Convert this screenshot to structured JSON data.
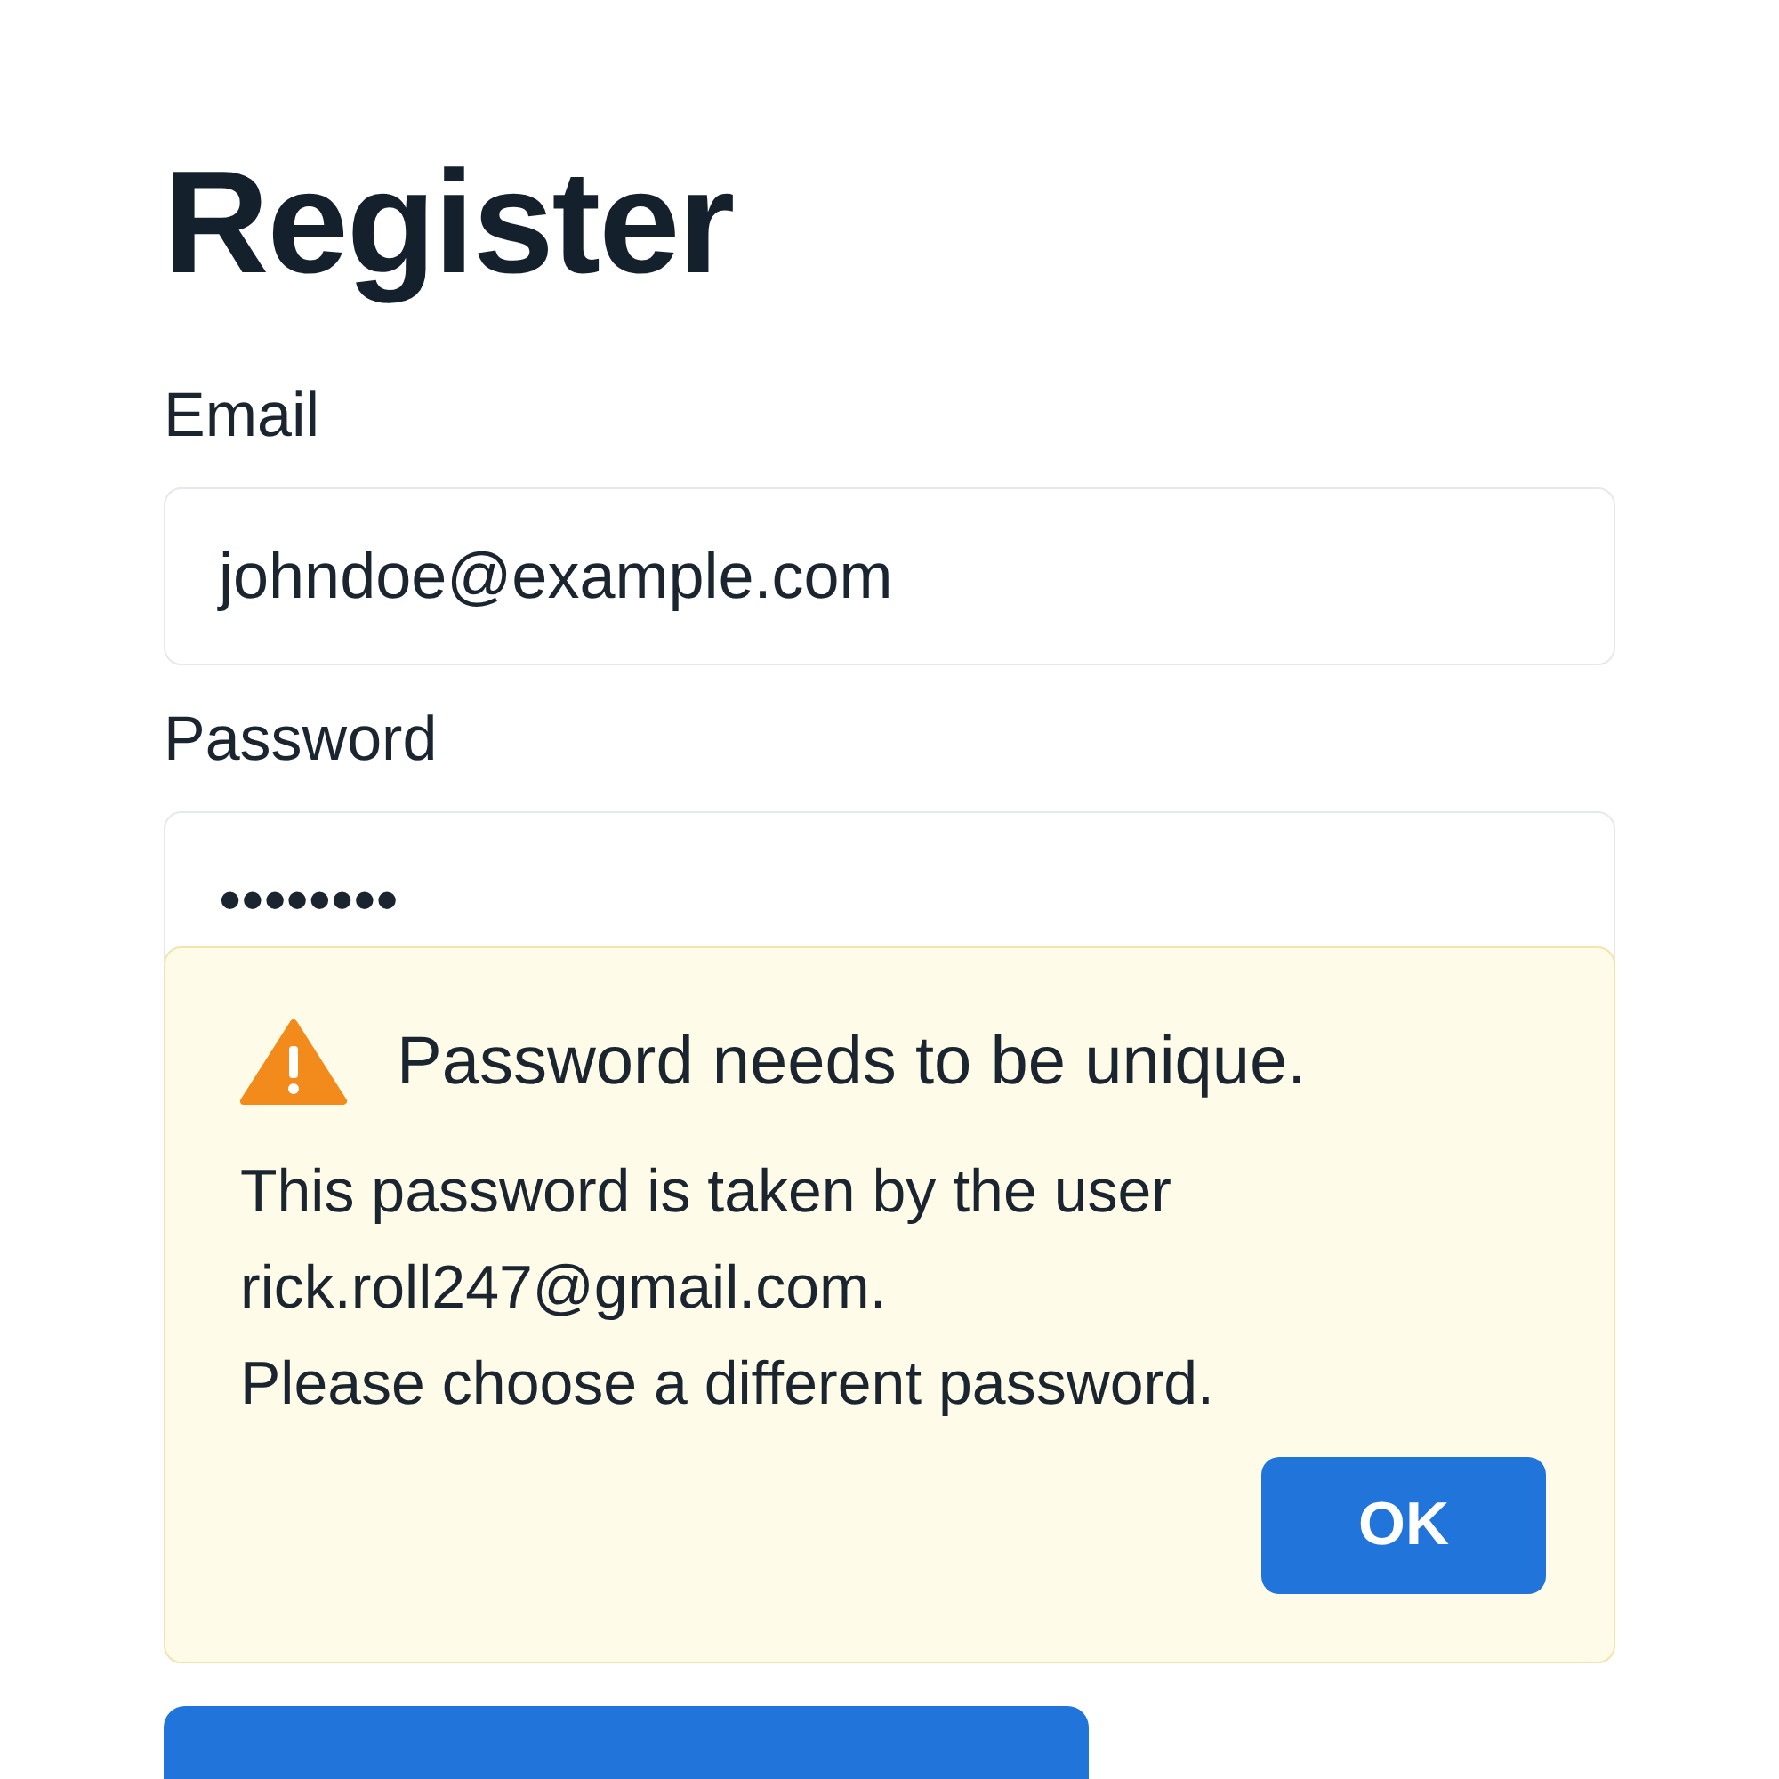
{
  "title": "Register",
  "fields": [
    {
      "label": "Email",
      "value": "johndoe@example.com"
    },
    {
      "label": "Password",
      "value": "••••••••"
    }
  ],
  "alert": {
    "title": "Password needs to be unique.",
    "lines": [
      "This password is taken by the user",
      "rick.roll247@gmail.com.",
      "Please choose a different password."
    ],
    "button": "OK"
  }
}
